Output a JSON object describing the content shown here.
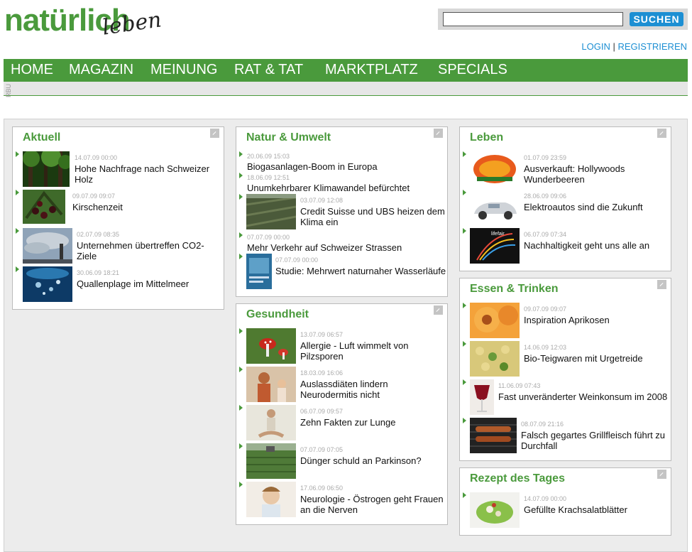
{
  "brand": {
    "logo_word1": "natürlich",
    "logo_word2": "leben",
    "accent": "#4a9a3c",
    "link_color": "#1d8fd3"
  },
  "search": {
    "placeholder": "",
    "button_label": "SUCHEN"
  },
  "auth": {
    "login": "LOGIN",
    "separator": "|",
    "register": "REGISTRIEREN"
  },
  "nav": [
    "HOME",
    "MAGAZIN",
    "MEINUNG",
    "RAT & TAT",
    "MARKTPLATZ",
    "SPECIALS"
  ],
  "subbar_text": "RBU",
  "sections": {
    "aktuell": {
      "title": "Aktuell",
      "items": [
        {
          "date": "14.07.09 00:00",
          "title1": "Hohe Nachfrage nach Schweizer",
          "title2": "Holz",
          "icon": "forest-photo"
        },
        {
          "date": "09.07.09 09:07",
          "title1": "Kirschenzeit",
          "title2": "",
          "icon": "cherries-photo"
        },
        {
          "date": "02.07.09 08:35",
          "title1": "Unternehmen übertreffen CO2-Ziele",
          "title2": "",
          "icon": "smokestack-photo"
        },
        {
          "date": "30.06.09 18:21",
          "title1": "Quallenplage im Mittelmeer",
          "title2": "",
          "icon": "sea-photo"
        }
      ]
    },
    "natur": {
      "title": "Natur & Umwelt",
      "items": [
        {
          "date": "20.06.09 15:03",
          "title1": "Biogasanlagen-Boom in Europa",
          "title2": ""
        },
        {
          "date": "18.06.09 12:51",
          "title1": "Unumkehrbarer Klimawandel befürchtet",
          "title2": ""
        },
        {
          "date": "03.07.09 12:08",
          "title1": "Credit Suisse und UBS heizen dem",
          "title2": "Klima ein",
          "icon": "plantation-photo"
        },
        {
          "date": "07.07.09 00:00",
          "title1": "Mehr Verkehr auf Schweizer Strassen",
          "title2": ""
        },
        {
          "date": "07.07.09 00:00",
          "title1": "Studie: Mehrwert naturnaher Wasserläufe",
          "title2": "",
          "icon": "booklet-photo"
        }
      ]
    },
    "gesundheit": {
      "title": "Gesundheit",
      "items": [
        {
          "date": "13.07.09 06:57",
          "title1": "Allergie - Luft wimmelt von",
          "title2": "Pilzsporen",
          "icon": "mushroom-photo"
        },
        {
          "date": "18.03.09 16:06",
          "title1": "Auslassdiäten lindern",
          "title2": "Neurodermitis nicht",
          "icon": "mother-child-photo"
        },
        {
          "date": "06.07.09 09:57",
          "title1": "Zehn Fakten zur Lunge",
          "title2": "",
          "icon": "yoga-photo"
        },
        {
          "date": "07.07.09 07:05",
          "title1": "Dünger schuld an Parkinson?",
          "title2": "",
          "icon": "field-photo"
        },
        {
          "date": "17.06.09 06:50",
          "title1": "Neurologie - Östrogen geht Frauen",
          "title2": "an die Nerven",
          "icon": "headache-photo"
        }
      ]
    },
    "leben": {
      "title": "Leben",
      "items": [
        {
          "date": "01.07.09 23:59",
          "title1": "Ausverkauft: Hollywoods",
          "title2": "Wunderbeeren",
          "icon": "goji-logo"
        },
        {
          "date": "28.06.09 09:06",
          "title1": "Elektroautos sind die Zukunft",
          "title2": "",
          "icon": "car-photo"
        },
        {
          "date": "06.07.09 07:34",
          "title1": "Nachhaltigkeit geht uns alle an",
          "title2": "",
          "icon": "lifefair-image",
          "image_text": "lifefair"
        }
      ]
    },
    "essen": {
      "title": "Essen & Trinken",
      "items": [
        {
          "date": "09.07.09 09:07",
          "title1": "Inspiration Aprikosen",
          "title2": "",
          "icon": "apricot-photo"
        },
        {
          "date": "14.06.09 12:03",
          "title1": "Bio-Teigwaren mit Urgetreide",
          "title2": "",
          "icon": "pasta-photo"
        },
        {
          "date": "11.06.09 07:43",
          "title1": "Fast unveränderter Weinkonsum im 2008",
          "title2": "",
          "icon": "wine-photo"
        },
        {
          "date": "08.07.09 21:16",
          "title1": "Falsch gegartes Grillfleisch führt zu",
          "title2": "Durchfall",
          "icon": "grill-photo"
        }
      ]
    },
    "rezept": {
      "title": "Rezept des Tages",
      "items": [
        {
          "date": "14.07.09 00:00",
          "title1": "Gefüllte Krachsalatblätter",
          "title2": "",
          "icon": "salad-photo"
        }
      ]
    }
  }
}
